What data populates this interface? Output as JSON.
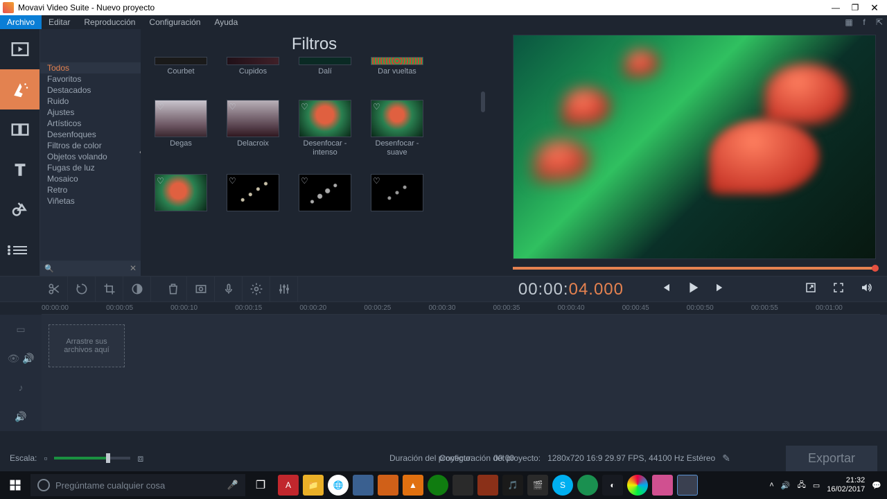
{
  "window": {
    "title": "Movavi Video Suite - Nuevo proyecto"
  },
  "menu": {
    "items": [
      "Archivo",
      "Editar",
      "Reproducción",
      "Configuración",
      "Ayuda"
    ],
    "active": 0
  },
  "panel": {
    "title": "Filtros",
    "categories": [
      "Todos",
      "Favoritos",
      "Destacados",
      "Ruido",
      "Ajustes",
      "Artísticos",
      "Desenfoques",
      "Filtros de color",
      "Objetos volando",
      "Fugas de luz",
      "Mosaico",
      "Retro",
      "Viñetas"
    ],
    "selected": 0,
    "filters_row0": [
      "Courbet",
      "Cupidos",
      "Dalí",
      "Dar vueltas"
    ],
    "filters_row1": [
      "Degas",
      "Delacroix",
      "Desenfocar - intenso",
      "Desenfocar - suave"
    ],
    "filters_row2": [
      "",
      "",
      "",
      ""
    ]
  },
  "playback": {
    "timecode_white": "00:00:",
    "timecode_orange": "04.000"
  },
  "ruler": [
    "00:00:00",
    "00:00:05",
    "00:00:10",
    "00:00:15",
    "00:00:20",
    "00:00:25",
    "00:00:30",
    "00:00:35",
    "00:00:40",
    "00:00:45",
    "00:00:50",
    "00:00:55",
    "00:01:00"
  ],
  "timeline": {
    "dropzone": "Arrastre sus archivos aquí"
  },
  "footer": {
    "scale_label": "Escala:",
    "config_label": "Configuración del proyecto:",
    "config_value": "1280x720 16:9 29.97 FPS, 44100 Hz Estéreo",
    "duration_label": "Duración del proyecto:",
    "duration_value": "00:00",
    "export": "Exportar"
  },
  "taskbar": {
    "search_placeholder": "Pregúntame cualquier cosa",
    "time": "21:32",
    "date": "16/02/2017"
  }
}
